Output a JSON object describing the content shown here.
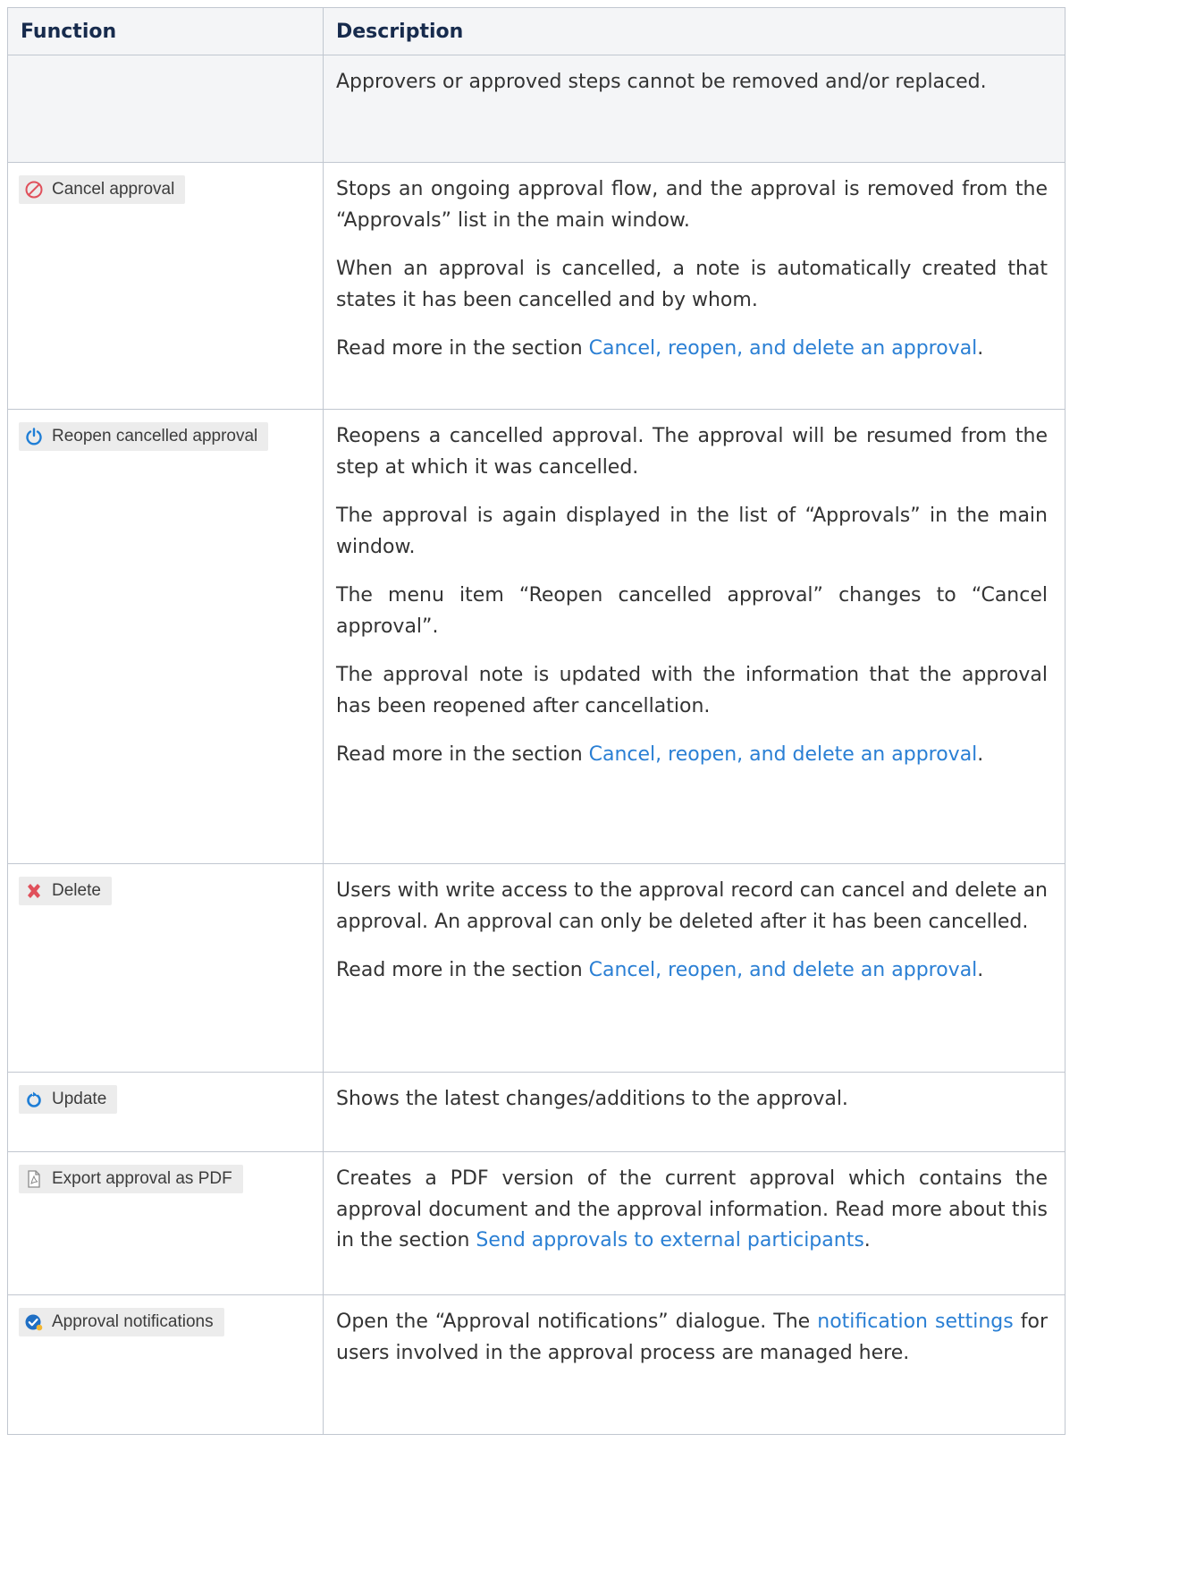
{
  "table": {
    "headers": {
      "function": "Function",
      "description": "Description"
    },
    "rows": [
      {
        "function": null,
        "icon": null,
        "paragraphs": [
          {
            "text": "Approvers or approved steps cannot be removed and/or replaced."
          }
        ]
      },
      {
        "function": "Cancel approval",
        "icon": "cancel-circle-icon",
        "icon_color": "#e0505b",
        "paragraphs": [
          {
            "text": "Stops an ongoing approval flow, and the approval is removed from the “Approvals” list in the main window."
          },
          {
            "text": "When an approval is cancelled, a note is automatically created that states it has been cancelled and by whom."
          },
          {
            "before": "Read more in the section ",
            "link": "Cancel, reopen, and delete an approval",
            "after": "."
          }
        ]
      },
      {
        "function": "Reopen cancelled approval",
        "icon": "power-icon",
        "icon_color": "#1f7ed6",
        "paragraphs": [
          {
            "text": "Reopens a cancelled approval. The approval will be resumed from the step at which it was cancelled."
          },
          {
            "text": "The approval is again displayed in the list of “Approvals” in the main window."
          },
          {
            "text": "The menu item “Reopen cancelled approval” changes to “Cancel approval”."
          },
          {
            "text": "The approval note is updated with the information that the approval has been reopened after cancellation."
          },
          {
            "before": "Read more in the section ",
            "link": "Cancel, reopen, and delete an approval",
            "after": "."
          }
        ]
      },
      {
        "function": "Delete",
        "icon": "delete-x-icon",
        "icon_color": "#e0505b",
        "paragraphs": [
          {
            "text": "Users with write access to the approval record can cancel and delete an approval. An approval can only be deleted after it has been cancelled."
          },
          {
            "before": "Read more in the section ",
            "link": "Cancel, reopen, and delete an approval",
            "after": "."
          }
        ]
      },
      {
        "function": "Update",
        "icon": "refresh-icon",
        "icon_color": "#1f7ed6",
        "paragraphs": [
          {
            "text": "Shows the latest changes/additions to the approval."
          }
        ]
      },
      {
        "function": "Export approval as PDF",
        "icon": "pdf-file-icon",
        "icon_color": "#8a8a8a",
        "paragraphs": [
          {
            "before": "Creates a PDF version of the current approval which contains the approval document and the approval information. Read more about this in the section ",
            "link": "Send approvals to external participants",
            "after": "."
          }
        ]
      },
      {
        "function": "Approval notifications",
        "icon": "approval-badge-icon",
        "icon_color": "#1f6fc4",
        "paragraphs": [
          {
            "before": "Open the “Approval notifications” dialogue. The ",
            "link": "notification settings",
            "after": " for users involved in the approval process are managed here."
          }
        ]
      }
    ]
  }
}
